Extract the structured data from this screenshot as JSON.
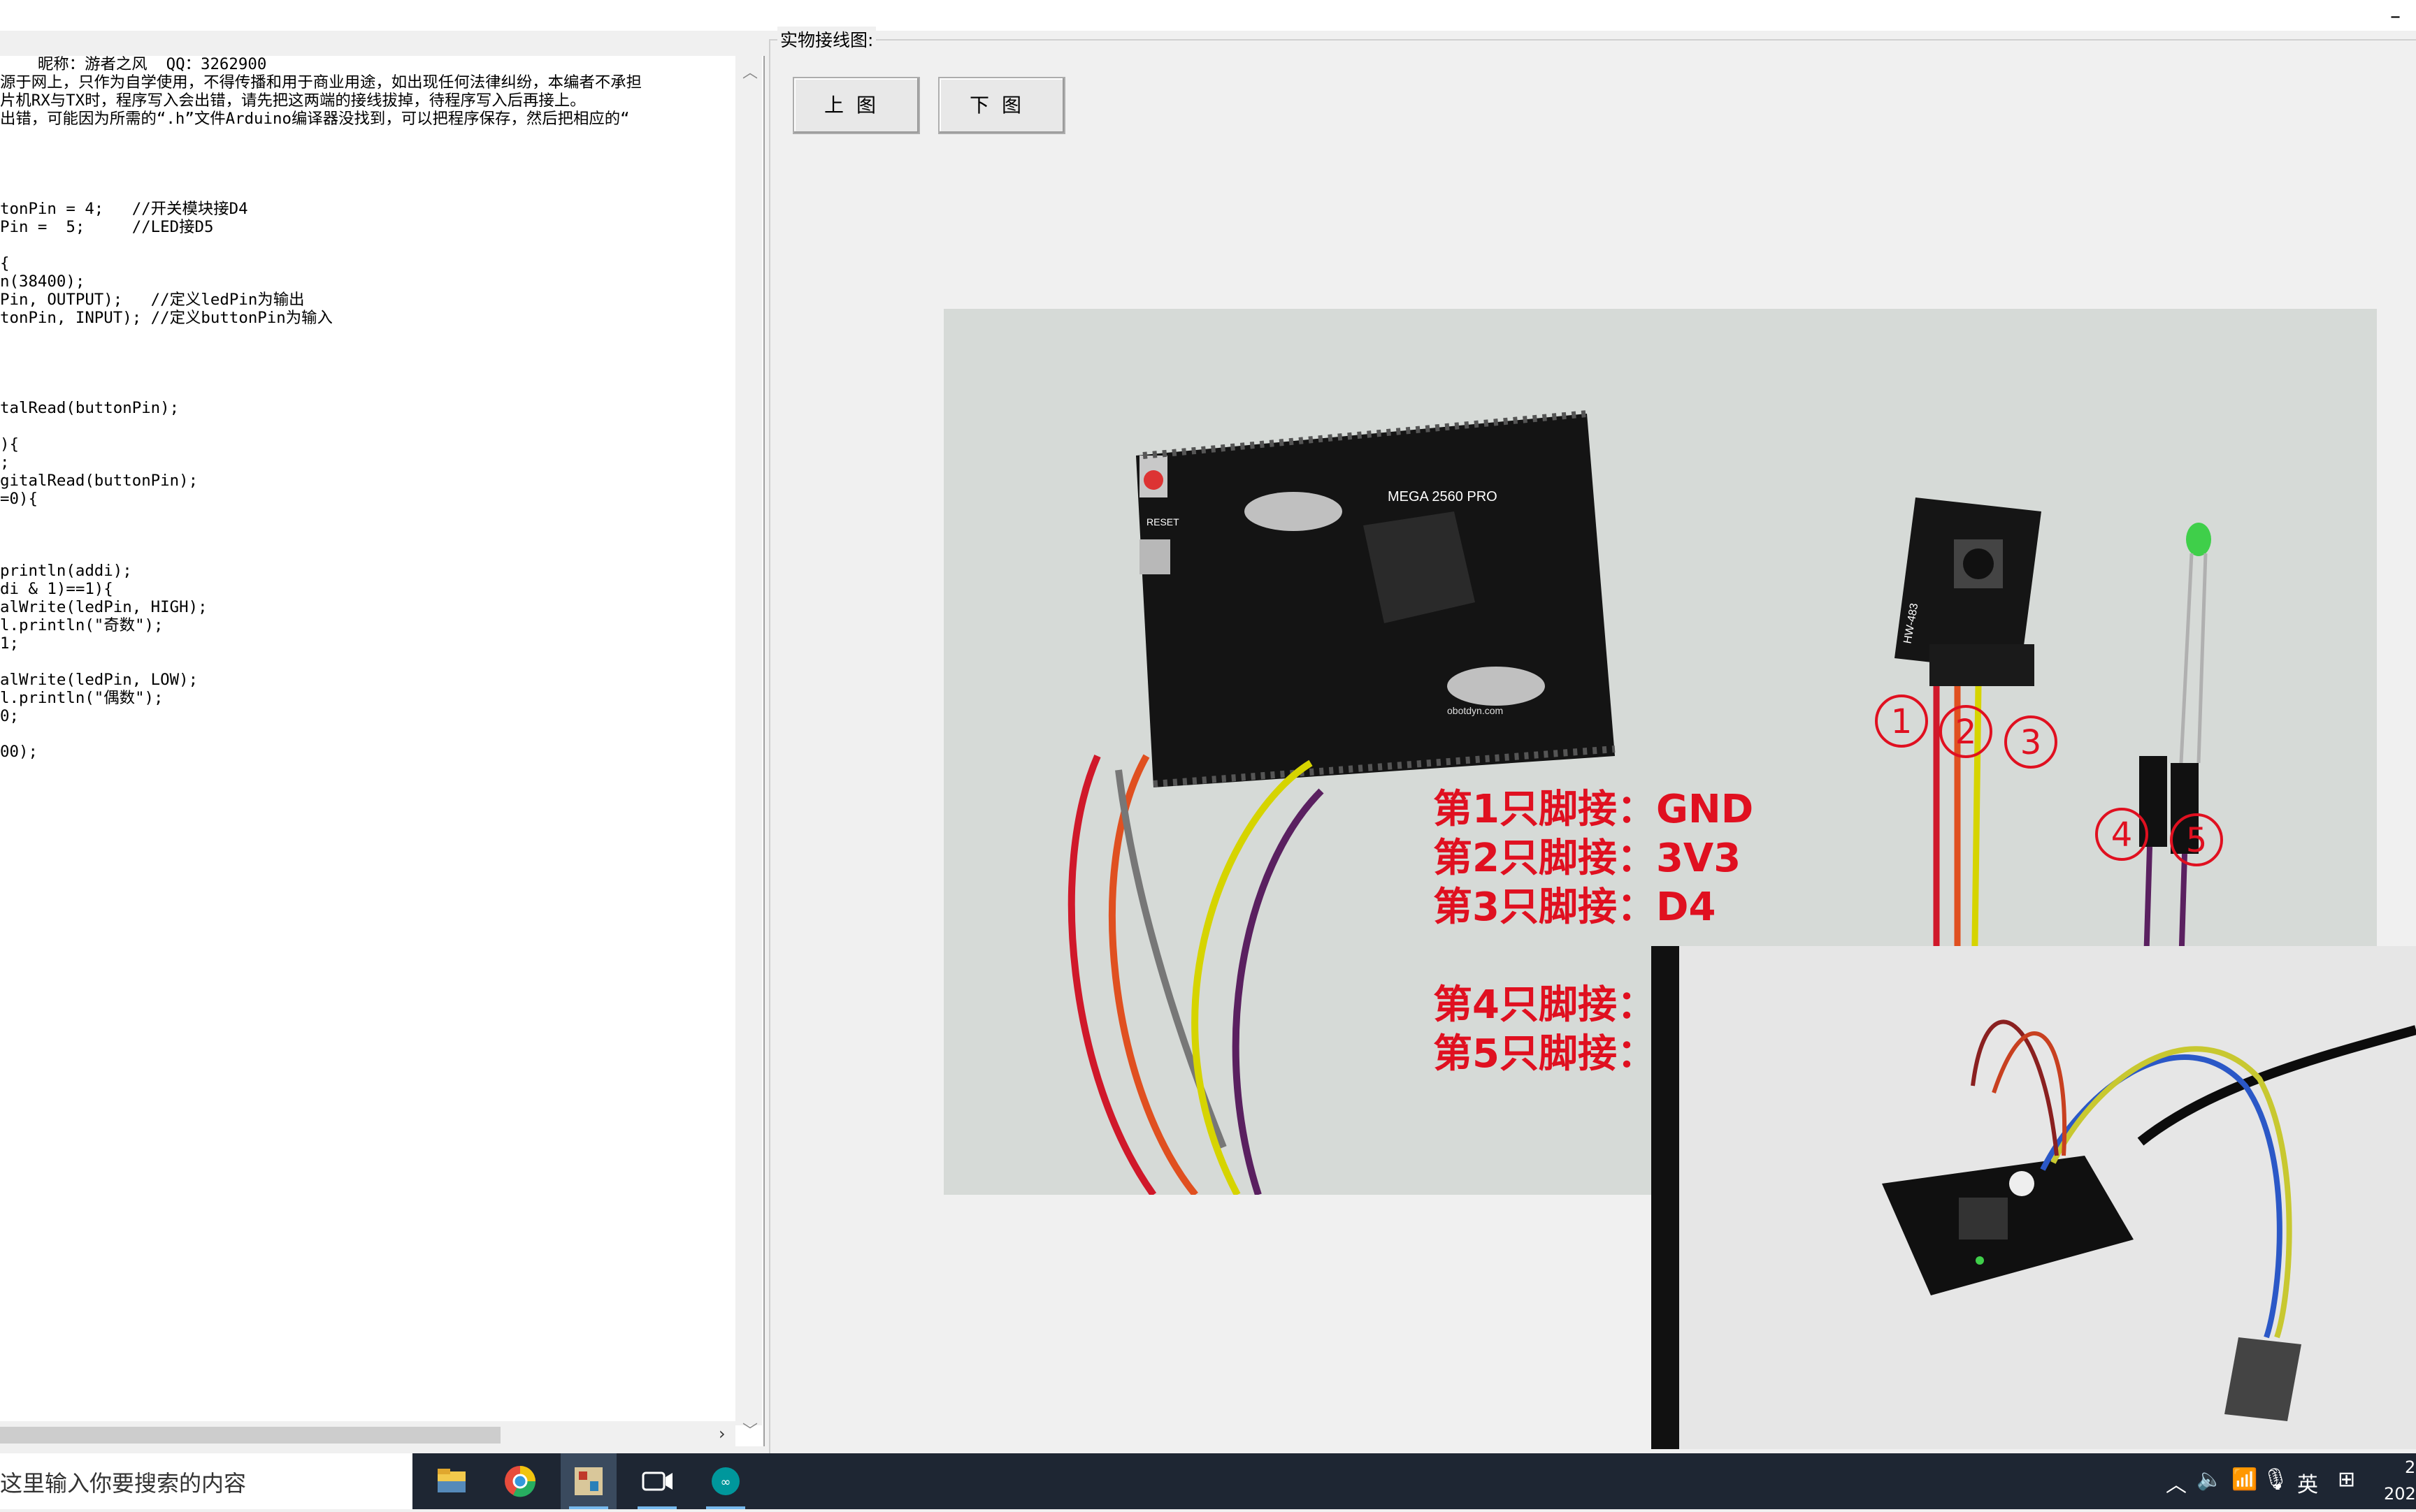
{
  "window": {
    "minimize_glyph": "–"
  },
  "code": {
    "lines": [
      "    昵称：游者之风  QQ：3262900",
      "源于网上，只作为自学使用，不得传播和用于商业用途，如出现任何法律纠纷，本编者不承担",
      "片机RX与TX时，程序写入会出错，请先把这两端的接线拔掉，待程序写入后再接上。",
      "出错，可能因为所需的“.h”文件Arduino编译器没找到，可以把程序保存，然后把相应的“",
      "",
      "",
      "",
      "",
      "tonPin = 4;   //开关模块接D4",
      "Pin =  5;     //LED接D5",
      "",
      "{",
      "n(38400);",
      "Pin, OUTPUT);   //定义ledPin为输出",
      "tonPin, INPUT); //定义buttonPin为输入",
      "",
      "",
      "",
      "",
      "talRead(buttonPin);",
      "",
      "){",
      ";",
      "gitalRead(buttonPin);",
      "=0){",
      "",
      "",
      "",
      "println(addi);",
      "di & 1)==1){",
      "alWrite(ledPin, HIGH);",
      "l.println(\"奇数\");",
      "1;",
      "",
      "alWrite(ledPin, LOW);",
      "l.println(\"偶数\");",
      "0;",
      "",
      "00);"
    ]
  },
  "panel": {
    "title": "实物接线图:",
    "btn_up": "上图",
    "btn_down": "下图"
  },
  "photo1": {
    "circle_labels": [
      "1",
      "2",
      "3",
      "4",
      "5"
    ],
    "pin_lines": [
      "第1只脚接：GND",
      "第2只脚接：3V3",
      "第3只脚接：D4",
      "第4只脚接：",
      "第5只脚接："
    ],
    "board_silkscreen": "MEGA 2560 PRO",
    "reset_label": "RESET",
    "site_label": "obotdyn.com",
    "module_label": "HW-483"
  },
  "taskbar": {
    "search_text": "在这里输入你要搜索的内容",
    "ime": "英",
    "clock_time": "2",
    "clock_date": "202"
  }
}
